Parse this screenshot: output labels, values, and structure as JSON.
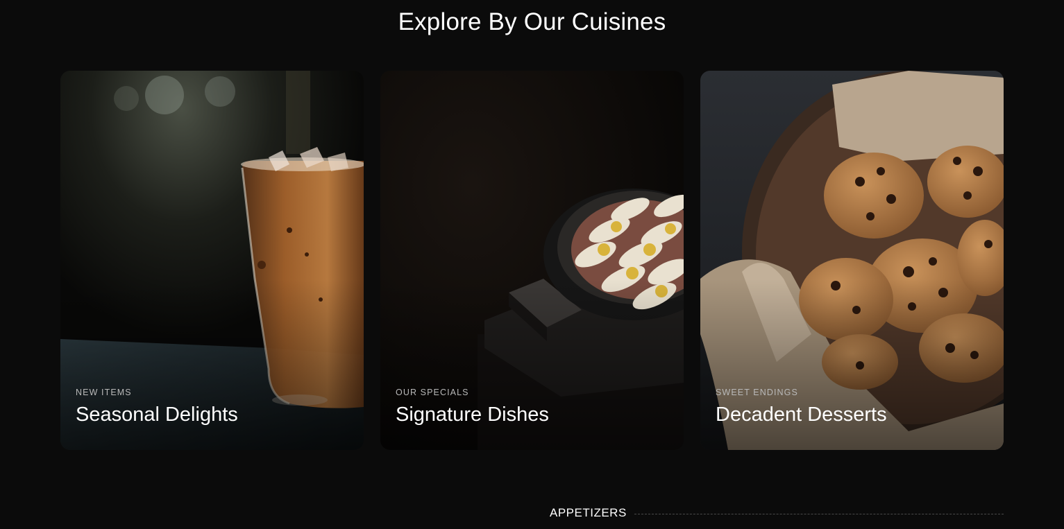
{
  "section": {
    "title": "Explore By Our Cuisines"
  },
  "cards": [
    {
      "eyebrow": "NEW ITEMS",
      "title": "Seasonal Delights",
      "image": "iced-coffee-photo"
    },
    {
      "eyebrow": "OUR SPECIALS",
      "title": "Signature Dishes",
      "image": "fish-claypot-photo"
    },
    {
      "eyebrow": "SWEET ENDINGS",
      "title": "Decadent Desserts",
      "image": "cookies-basket-photo"
    }
  ],
  "menu": {
    "heading": "APPETIZERS"
  },
  "colors": {
    "background": "#0b0b0b",
    "text": "#ffffff",
    "eyebrow": "#b9b9b9",
    "rule": "#4a4a4a"
  }
}
